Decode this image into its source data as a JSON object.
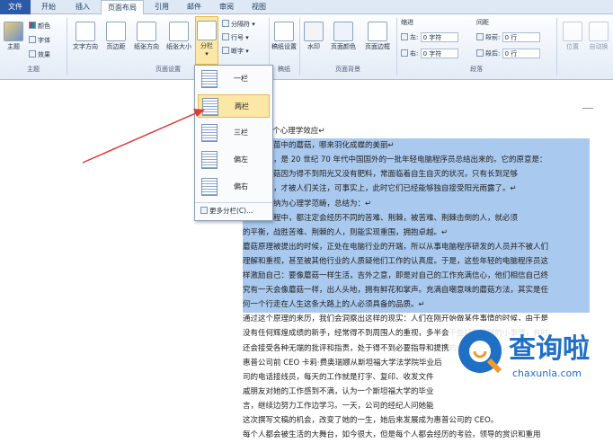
{
  "tabs": [
    "文件",
    "开始",
    "插入",
    "页面布局",
    "引用",
    "邮件",
    "审阅",
    "视图"
  ],
  "theme": {
    "big": "主题",
    "colors": "颜色",
    "fonts": "字体",
    "effects": "效果",
    "group": "主题"
  },
  "page_setup": {
    "text_dir": "文字方向",
    "margins": "页边距",
    "orientation": "纸张方向",
    "size": "纸张大小",
    "columns": "分栏",
    "breaks": "分隔符",
    "line_numbers": "行号",
    "hyphen": "断字",
    "group": "页面设置"
  },
  "draft": {
    "label": "稿纸设置",
    "group": "稿纸"
  },
  "page_bg": {
    "watermark": "水印",
    "page_color": "页面颜色",
    "page_border": "页面边框",
    "group": "页面背景"
  },
  "paragraph": {
    "indent": "缩进",
    "spacing": "间距",
    "left": "左:",
    "right": "右:",
    "before": "段前:",
    "after": "段后:",
    "left_val": "0 字符",
    "right_val": "0 字符",
    "before_val": "0 行",
    "after_val": "0 行",
    "group": "段落"
  },
  "arrange": {
    "position": "位置",
    "wrap": "自动换"
  },
  "columns_menu": {
    "items": [
      "一栏",
      "两栏",
      "三栏",
      "偏左",
      "偏右"
    ],
    "more": "更多分栏(C)..."
  },
  "doc_lines": [
    {
      "t": "生的 60 个心理学效应↵",
      "s": false
    },
    {
      "t": "理：没有苗中的蘑菇，哪来羽化成蝶的美丽↵",
      "s": true
    },
    {
      "t": "样的说法，是 20 世纪 70 年代中国国外的一批年轻电脑程序员总结出来的。它的原意是：",
      "s": true
    },
    {
      "t": "角落的蘑菇因为得不到阳光又没有肥料，常面临着自生自灭的状况，只有长到足够",
      "s": true
    },
    {
      "t": "长的时候，才被人们关注，可事实上，此时它们已经能够独自接受阳光雨露了。↵",
      "s": true
    },
    {
      "t": "学家将其纳为心理学范畴，总结为：↵",
      "s": true
    },
    {
      "t": "在成长过程中，都注定会经历不同的苦难、荆棘，被苦难、荆棘击倒的人，就必须",
      "s": true
    },
    {
      "t": "的平衡，战胜苦难、荆棘的人，则能实现重围，拥抱卓越。↵",
      "s": true
    },
    {
      "t": "蘑菇原理被提出的时候，正处在电脑行业的开端，所以从事电脑程序研发的人员并不被人们",
      "s": true
    },
    {
      "t": "理解和重视，甚至被其他行业的人质疑他们工作的认真度。于是，这些年轻的电脑程序员这",
      "s": true
    },
    {
      "t": "样激励自己：要像蘑菇一样生活，吉外之意，即是对自己的工作充满信心，他们相信自己终",
      "s": true
    },
    {
      "t": "究有一天会像蘑菇一样，出人头地，拥有鲜花和掌声。充满自嘲意味的蘑菇方法，其实是任",
      "s": true
    },
    {
      "t": "何一个行走在人生这条大路上的人必须具备的品质。↵",
      "s": true
    },
    {
      "t": "通过这个原理的来历，我们会洞察出这样的现实：人们在刚开始做某件事情的时候，由于是",
      "s": false
    },
    {
      "t": "没有任何辉煌成绩的新手，经常得不到周围人的重视，多半会干些打杂跑腿的小事情，有时",
      "s": false
    },
    {
      "t": "还会接受各种无端的批评和指责，处于得不到必要指导和提携的自生自灭之中。",
      "s": false
    },
    {
      "t": "惠普公司前 CEO 卡莉·费奥瑞娜从斯坦福大学法学院毕业后",
      "s": false
    },
    {
      "t": "司的电话接线员，每天的工作就是打字、复印、收发文件",
      "s": false
    },
    {
      "t": "戚朋友对她的工作感到不满，认为一个斯坦福大学的毕业",
      "s": false
    },
    {
      "t": "言，继续边努力工作边学习。一天，公司的经纪人问她能",
      "s": false
    },
    {
      "t": "这次撰写文稿的机会，改变了她的一生，她后来发展成为惠普公司的 CEO。",
      "s": false
    },
    {
      "t": "每个人都会被生活的大舞台，如今很大，但是每个人都会经历的考验，领导的赏识和重用",
      "s": false
    }
  ],
  "logo": {
    "cn": "查询啦",
    "url": "chaxunla.com"
  },
  "colors": {
    "arrow": "#e03a3a",
    "selection": "#a9c9ee",
    "logo_blue": "#1f6fc5",
    "logo_orange": "#f29a2e"
  }
}
